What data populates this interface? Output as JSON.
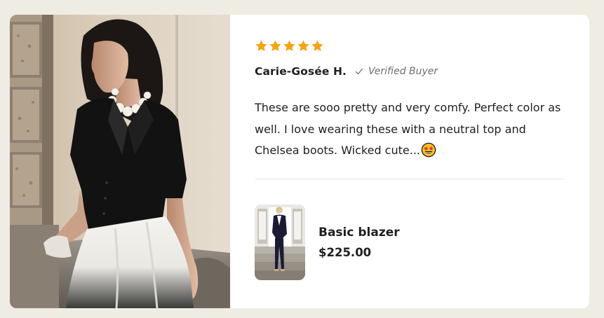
{
  "review": {
    "rating": 5,
    "max_rating": 5,
    "reviewer_name": "Carie-Gosée H.",
    "verified_label": "Verified Buyer",
    "text": "These are sooo pretty and very comfy. Perfect color as well. I love wearing these with a neutral top and Chelsea boots. Wicked cute...",
    "emoji": "star-struck-emoji-icon"
  },
  "product": {
    "name": "Basic blazer",
    "price": "$225.00"
  },
  "colors": {
    "page_background": "#efece4",
    "card_background": "#ffffff",
    "star": "#f5a416",
    "text": "#1f1f1f",
    "muted_text": "#6f6f6f",
    "divider": "#e7e7e7"
  }
}
